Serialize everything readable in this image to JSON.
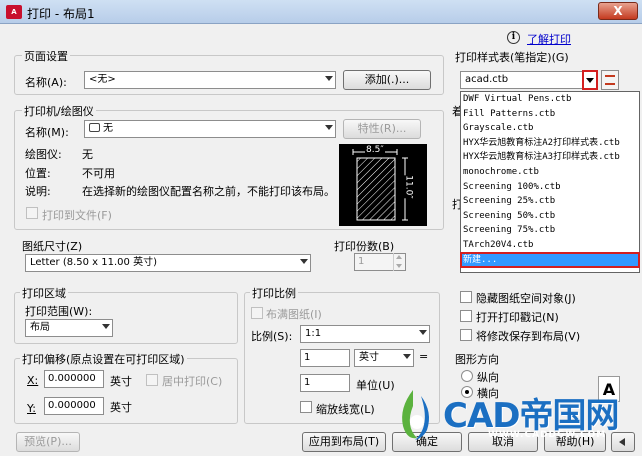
{
  "window": {
    "title": "打印 - 布局1",
    "app_icon": "autocad-icon",
    "close_label": "X"
  },
  "help": {
    "info_label": "i",
    "link": "了解打印"
  },
  "page_setup": {
    "group": "页面设置",
    "name_label": "名称(A):",
    "name_value": "<无>",
    "add_button": "添加(.)..."
  },
  "printer": {
    "group": "打印机/绘图仪",
    "name_label": "名称(M):",
    "name_value": "无",
    "properties_button": "特性(R)...",
    "plotter_label": "绘图仪:",
    "plotter_value": "无",
    "location_label": "位置:",
    "location_value": "不可用",
    "desc_label": "说明:",
    "desc_value": "在选择新的绘图仪配置名称之前，不能打印该布局。",
    "print_to_file": "打印到文件(F)",
    "preview_width": "8.5″",
    "preview_height": "11.0″"
  },
  "paper": {
    "group": "图纸尺寸(Z)",
    "value": "Letter (8.50 x 11.00 英寸)"
  },
  "copies": {
    "label": "打印份数(B)",
    "value": "1"
  },
  "plot_area": {
    "group": "打印区域",
    "range_label": "打印范围(W):",
    "range_value": "布局"
  },
  "plot_offset": {
    "group": "打印偏移(原点设置在可打印区域)",
    "x_label": "X:",
    "x_value": "0.000000",
    "x_unit": "英寸",
    "center_label": "居中打印(C)",
    "y_label": "Y:",
    "y_value": "0.000000",
    "y_unit": "英寸"
  },
  "plot_scale": {
    "group": "打印比例",
    "fit_label": "布满图纸(I)",
    "scale_label": "比例(S):",
    "scale_value": "1:1",
    "value1": "1",
    "unit1": "英寸",
    "eq": "=",
    "value2": "1",
    "unit2": "单位(U)",
    "lineweight_label": "缩放线宽(L)"
  },
  "plot_style": {
    "group": "打印样式表(笔指定)(G)",
    "value": "acad.ctb",
    "items": [
      "DWF Virtual Pens.ctb",
      "Fill Patterns.ctb",
      "Grayscale.ctb",
      "HYX华云旭教育标注A2打印样式表.ctb",
      "HYX华云旭教育标注A3打印样式表.ctb",
      "monochrome.ctb",
      "Screening 100%.ctb",
      "Screening 25%.ctb",
      "Screening 50%.ctb",
      "Screening 75%.ctb",
      "TArch20V4.ctb",
      "新建..."
    ],
    "partial_label_1": "着",
    "partial_label_2": "打"
  },
  "options": {
    "hide_paperspace": "隐藏图纸空间对象(J)",
    "stamp": "打开打印戳记(N)",
    "save_changes": "将修改保存到布局(V)"
  },
  "orientation": {
    "group": "图形方向",
    "portrait": "纵向",
    "landscape": "横向",
    "glyph": "A"
  },
  "footer": {
    "preview_button": "预览(P)...",
    "apply_button": "应用到布局(T)",
    "ok_button": "确定",
    "cancel_button": "取消",
    "help_button": "帮助(H)"
  },
  "watermark": {
    "text": "CAD帝国网",
    "url": "WWW.CADDGW.COM"
  }
}
